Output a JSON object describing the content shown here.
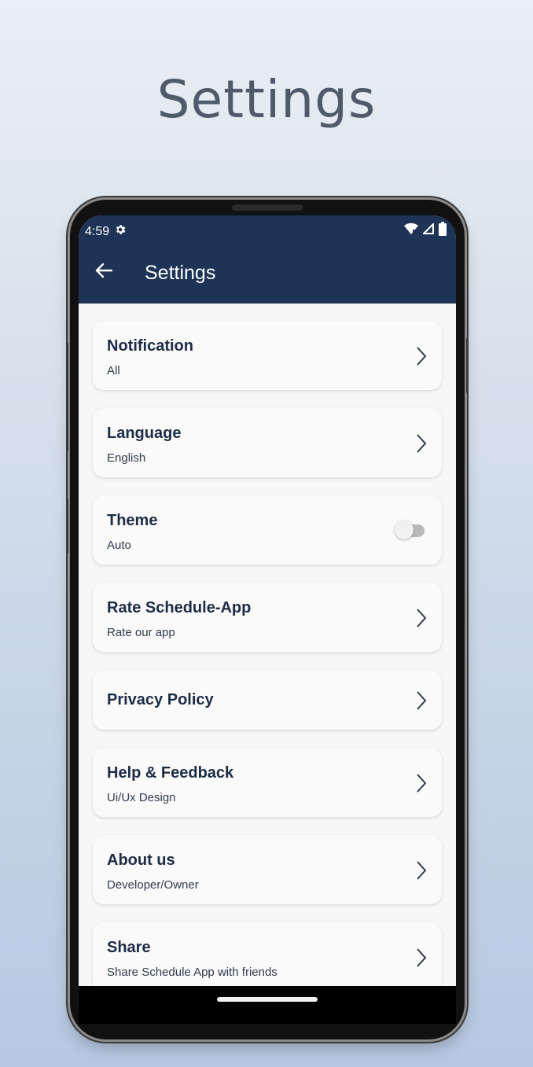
{
  "promo": {
    "title": "Settings"
  },
  "status_bar": {
    "time": "4:59"
  },
  "app_bar": {
    "title": "Settings"
  },
  "colors": {
    "app_bar": "#1d3456",
    "title_text": "#1c2c45"
  },
  "items": [
    {
      "title": "Notification",
      "subtitle": "All",
      "control": "chevron"
    },
    {
      "title": "Language",
      "subtitle": "English",
      "control": "chevron"
    },
    {
      "title": "Theme",
      "subtitle": "Auto",
      "control": "toggle",
      "toggle_on": false
    },
    {
      "title": "Rate Schedule-App",
      "subtitle": "Rate our app",
      "control": "chevron"
    },
    {
      "title": "Privacy Policy",
      "subtitle": "",
      "control": "chevron"
    },
    {
      "title": "Help & Feedback",
      "subtitle": "Ui/Ux Design",
      "control": "chevron"
    },
    {
      "title": "About us",
      "subtitle": "Developer/Owner",
      "control": "chevron"
    },
    {
      "title": "Share",
      "subtitle": "Share Schedule App with friends",
      "control": "chevron"
    }
  ]
}
